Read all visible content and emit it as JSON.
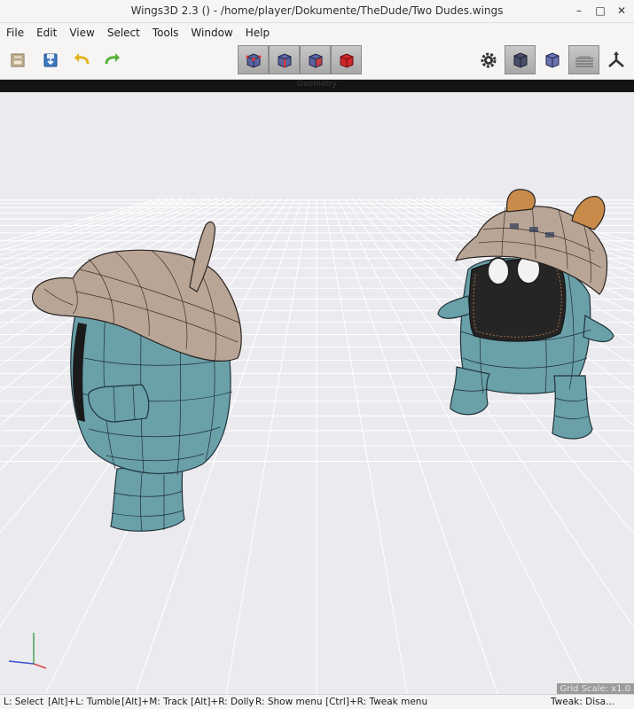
{
  "window": {
    "title": "Wings3D 2.3 () - /home/player/Dokumente/TheDude/Two Dudes.wings",
    "minimize_glyph": "–",
    "maximize_glyph": "□",
    "close_glyph": "✕"
  },
  "menu": {
    "items": [
      "File",
      "Edit",
      "View",
      "Select",
      "Tools",
      "Window",
      "Help"
    ]
  },
  "toolbar": {
    "left_icons": [
      "open-file-icon",
      "save-file-icon",
      "undo-icon",
      "redo-icon"
    ],
    "selection_modes": [
      "vertex-mode-icon",
      "edge-mode-icon",
      "face-mode-icon",
      "body-mode-icon"
    ],
    "right_icons": [
      "settings-gear-icon",
      "smooth-shaded-icon",
      "wireframe-cube-icon",
      "ground-plane-icon",
      "orthographic-axes-icon"
    ]
  },
  "geometry_bar": {
    "label": "Geometry"
  },
  "viewport": {
    "background_color": "#ebeaee",
    "grid_color": "#ffffff",
    "body_color": "#6aa0a8",
    "cap_color": "#b8a596",
    "ear_color": "#c98b4a",
    "axes": [
      "x",
      "y",
      "z"
    ]
  },
  "status": {
    "select": "L: Select",
    "tumble": "[Alt]+L: Tumble",
    "track": "[Alt]+M: Track",
    "dolly": "[Alt]+R: Dolly",
    "show_menu": "R: Show menu",
    "tweak_menu": "[Ctrl]+R: Tweak menu",
    "tweak_state": "Tweak: Disa...",
    "grid_scale": "Grid Scale: x1.0"
  }
}
